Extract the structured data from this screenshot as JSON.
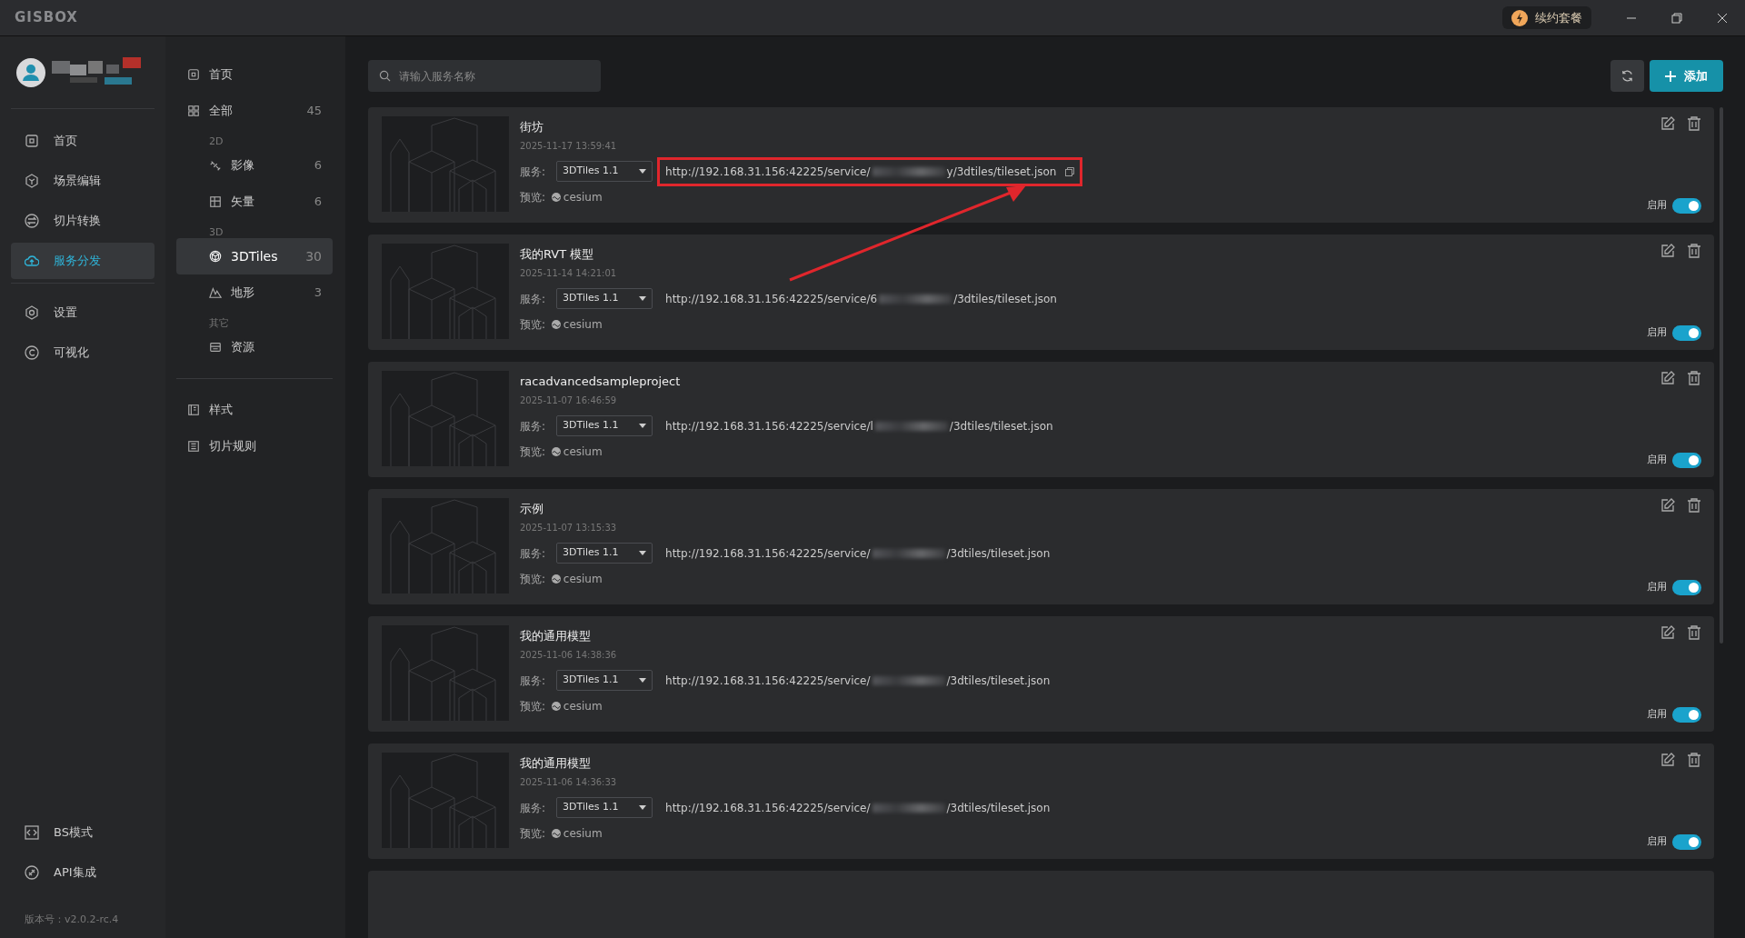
{
  "window": {
    "title": "GISBOX",
    "renew_button": "续约套餐"
  },
  "nav": {
    "items": [
      {
        "label": "首页",
        "selected": false
      },
      {
        "label": "场景编辑",
        "selected": false
      },
      {
        "label": "切片转换",
        "selected": false
      },
      {
        "label": "服务分发",
        "selected": true
      },
      {
        "label": "设置",
        "selected": false
      },
      {
        "label": "可视化",
        "selected": false
      }
    ],
    "bottom_items": [
      {
        "label": "BS模式"
      },
      {
        "label": "API集成"
      }
    ],
    "version": "版本号：v2.0.2-rc.4"
  },
  "categories": [
    {
      "kind": "item",
      "label": "首页",
      "selected": false
    },
    {
      "kind": "item",
      "label": "全部",
      "count": "45",
      "selected": false
    },
    {
      "kind": "header",
      "label": "2D"
    },
    {
      "kind": "subitem",
      "label": "影像",
      "count": "6",
      "selected": false
    },
    {
      "kind": "subitem",
      "label": "矢量",
      "count": "6",
      "selected": false
    },
    {
      "kind": "header",
      "label": "3D"
    },
    {
      "kind": "subitem",
      "label": "3DTiles",
      "count": "30",
      "selected": true
    },
    {
      "kind": "subitem",
      "label": "地形",
      "count": "3",
      "selected": false
    },
    {
      "kind": "header",
      "label": "其它"
    },
    {
      "kind": "subitem",
      "label": "资源",
      "selected": false
    },
    {
      "kind": "divider"
    },
    {
      "kind": "item",
      "label": "样式",
      "selected": false
    },
    {
      "kind": "item",
      "label": "切片规则",
      "selected": false
    }
  ],
  "toolbar": {
    "search_placeholder": "请输入服务名称",
    "add_button": "添加"
  },
  "services": [
    {
      "title": "街坊",
      "time": "2025-11-17 13:59:41",
      "service_label": "服务:",
      "service_value": "3DTiles 1.1",
      "url_start": "http://192.168.31.156:42225/service/",
      "url_end": "y/3dtiles/tileset.json",
      "copy_icon": true,
      "highlighted": true,
      "preview_label": "预览:",
      "preview_value": "cesium",
      "enabled_label": "启用",
      "enabled": true
    },
    {
      "title": "我的RVT 模型",
      "time": "2025-11-14 14:21:01",
      "service_label": "服务:",
      "service_value": "3DTiles 1.1",
      "url_start": "http://192.168.31.156:42225/service/6",
      "url_end": "/3dtiles/tileset.json",
      "copy_icon": false,
      "highlighted": false,
      "preview_label": "预览:",
      "preview_value": "cesium",
      "enabled_label": "启用",
      "enabled": true
    },
    {
      "title": "racadvancedsampleproject",
      "time": "2025-11-07 16:46:59",
      "service_label": "服务:",
      "service_value": "3DTiles 1.1",
      "url_start": "http://192.168.31.156:42225/service/l",
      "url_end": "/3dtiles/tileset.json",
      "copy_icon": false,
      "highlighted": false,
      "preview_label": "预览:",
      "preview_value": "cesium",
      "enabled_label": "启用",
      "enabled": true
    },
    {
      "title": "示例",
      "time": "2025-11-07 13:15:33",
      "service_label": "服务:",
      "service_value": "3DTiles 1.1",
      "url_start": "http://192.168.31.156:42225/service/",
      "url_end": "/3dtiles/tileset.json",
      "copy_icon": false,
      "highlighted": false,
      "preview_label": "预览:",
      "preview_value": "cesium",
      "enabled_label": "启用",
      "enabled": true
    },
    {
      "title": "我的通用模型",
      "time": "2025-11-06 14:38:36",
      "service_label": "服务:",
      "service_value": "3DTiles 1.1",
      "url_start": "http://192.168.31.156:42225/service/",
      "url_end": "/3dtiles/tileset.json",
      "copy_icon": false,
      "highlighted": false,
      "preview_label": "预览:",
      "preview_value": "cesium",
      "enabled_label": "启用",
      "enabled": true
    },
    {
      "title": "我的通用模型",
      "time": "2025-11-06 14:36:33",
      "service_label": "服务:",
      "service_value": "3DTiles 1.1",
      "url_start": "http://192.168.31.156:42225/service/",
      "url_end": "/3dtiles/tileset.json",
      "copy_icon": false,
      "highlighted": false,
      "preview_label": "预览:",
      "preview_value": "cesium",
      "enabled_label": "启用",
      "enabled": true
    }
  ]
}
